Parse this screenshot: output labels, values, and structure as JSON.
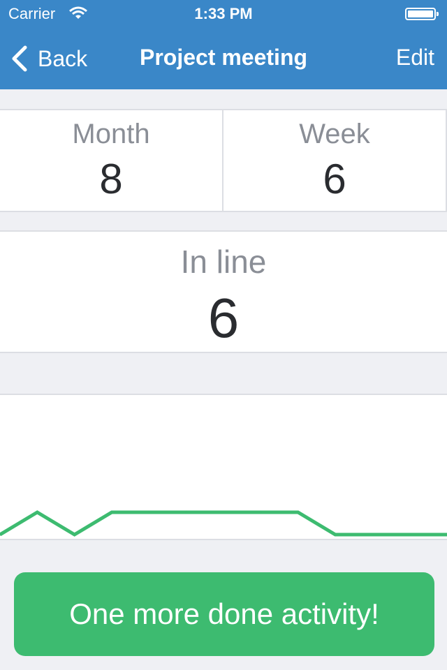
{
  "status_bar": {
    "carrier": "Carrier",
    "time": "1:33 PM",
    "wifi_icon": "wifi-icon",
    "battery_icon": "battery-icon"
  },
  "nav": {
    "back_label": "Back",
    "back_icon": "chevron-left-icon",
    "title": "Project meeting",
    "edit_label": "Edit",
    "color": "#3a87c8"
  },
  "stats": {
    "month_label": "Month",
    "month_value": "8",
    "week_label": "Week",
    "week_value": "6"
  },
  "in_line": {
    "label": "In line",
    "value": "6"
  },
  "chart_data": {
    "type": "line",
    "x": [
      0,
      1,
      2,
      3,
      4,
      5,
      6,
      7,
      8,
      9,
      10,
      11,
      12
    ],
    "series": [
      {
        "values": [
          1,
          2,
          1,
          2,
          2,
          2,
          2,
          2,
          2,
          1,
          1,
          1,
          1
        ],
        "color": "#3dbb70"
      }
    ],
    "ylim": [
      0,
      6
    ],
    "grid": false,
    "title": "",
    "xlabel": "",
    "ylabel": ""
  },
  "action": {
    "label": "One more done activity!",
    "color": "#3dbb70"
  }
}
